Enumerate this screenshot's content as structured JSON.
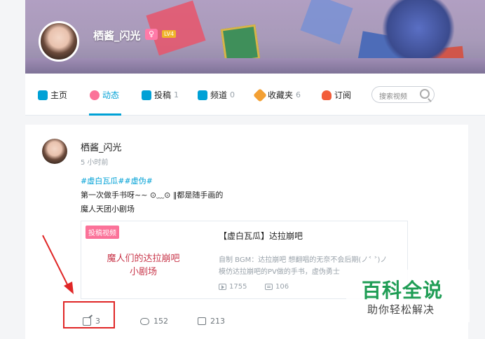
{
  "profile": {
    "username": "栖酱_闪光",
    "gender_symbol": "♀",
    "level": "LV4"
  },
  "nav": {
    "items": [
      {
        "label": "主页",
        "count": "",
        "icon": "home-icon",
        "color": "#00a1d6"
      },
      {
        "label": "动态",
        "count": "",
        "icon": "dynamic-icon",
        "color": "#fb7299"
      },
      {
        "label": "投稿",
        "count": "1",
        "icon": "upload-icon",
        "color": "#00a1d6"
      },
      {
        "label": "频道",
        "count": "0",
        "icon": "channel-icon",
        "color": "#00a1d6"
      },
      {
        "label": "收藏夹",
        "count": "6",
        "icon": "favorite-icon",
        "color": "#f3a034"
      },
      {
        "label": "订阅",
        "count": "",
        "icon": "subscribe-icon",
        "color": "#f25d3a"
      }
    ],
    "search_placeholder": "搜索视频"
  },
  "feed": {
    "author": "栖酱_闪光",
    "time": "5 小时前",
    "tags": "#虚白瓦瓜##虚伪#",
    "line1": "第一次做手书呀~~ ⊙﹏⊙ ‖都是随手画的",
    "line2": "魔人天团小剧场",
    "video": {
      "badge": "投稿视频",
      "thumb_line1": "魔人们的达拉崩吧",
      "thumb_line2": "小剧场",
      "title": "【虚白瓦瓜】达拉崩吧",
      "desc1": "自制 BGM：达拉崩吧 想翻唱的无奈不会后期(ノ˂ ˃)ノ",
      "desc2": "模仿达拉崩吧的PV做的手书，虚伪勇士",
      "plays": "1755",
      "danmaku": "106"
    },
    "actions": {
      "shares": "3",
      "comments": "152",
      "likes": "213"
    }
  },
  "watermark": {
    "title": "百科全说",
    "subtitle": "助你轻松解决"
  },
  "colors": {
    "accent": "#00a1d6",
    "pink": "#fb7299",
    "annotation_red": "#e02626",
    "watermark_green": "#1f9d55"
  }
}
